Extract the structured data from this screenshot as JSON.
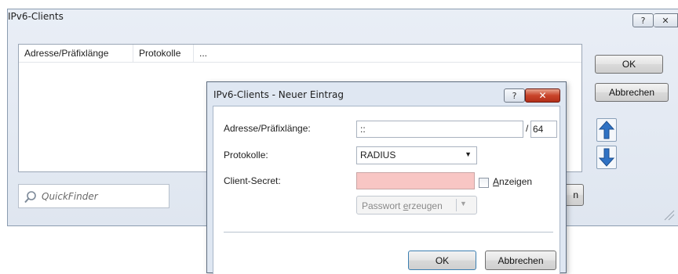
{
  "outer": {
    "title": "IPv6-Clients",
    "help_label": "?",
    "close_label": "✕",
    "columns": [
      "Adresse/Präfixlänge",
      "Protokolle",
      "..."
    ],
    "ok_label": "OK",
    "cancel_label": "Abbrechen",
    "quickfinder_placeholder": "QuickFinder",
    "hidden_button_label": "n"
  },
  "dialog": {
    "title": "IPv6-Clients - Neuer Eintrag",
    "help_label": "?",
    "close_label": "✕",
    "address_label": "Adresse/Präfixlänge:",
    "address_value": "::",
    "prefix_separator": "/",
    "prefix_value": "64",
    "protocol_label": "Protokolle:",
    "protocol_value": "RADIUS",
    "secret_label": "Client-Secret:",
    "secret_value": "",
    "show_label_prefix": "",
    "show_label_accel": "A",
    "show_label_rest": "nzeigen",
    "generate_prefix": "Passwort ",
    "generate_accel": "e",
    "generate_rest": "rzeugen",
    "ok_label": "OK",
    "cancel_label": "Abbrechen"
  },
  "colors": {
    "secret_field_bg": "#f8c6c4",
    "close_red": "#c9442a",
    "arrow_blue": "#2f72c4"
  },
  "icons": [
    "help-icon",
    "close-icon",
    "arrow-up-icon",
    "arrow-down-icon",
    "magnifier-icon",
    "dropdown-arrow-icon",
    "resize-grip-icon"
  ]
}
